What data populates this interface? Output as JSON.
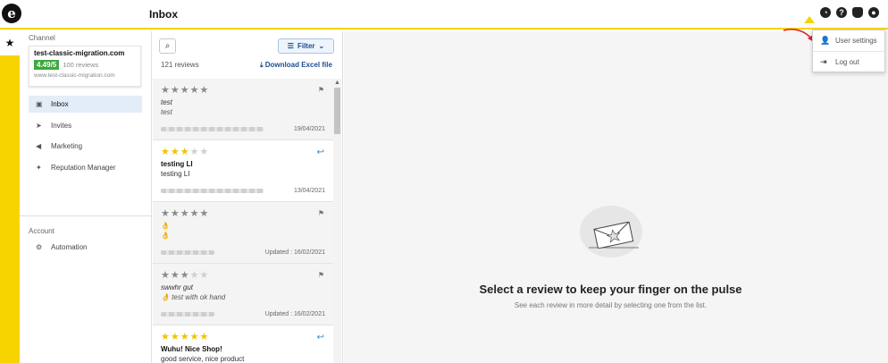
{
  "header": {
    "logo": "e",
    "title": "Inbox",
    "icons": [
      "speed-icon",
      "help-icon",
      "bell-icon",
      "user-icon"
    ]
  },
  "rail": {
    "star": "★"
  },
  "sidebar": {
    "channel_label": "Channel",
    "channel": {
      "name": "test-classic-migration.com",
      "rating": "4.49/5",
      "reviews": "100 reviews",
      "url": "www.test-classic-migration.com"
    },
    "items": [
      {
        "label": "Inbox",
        "icon": "inbox-icon"
      },
      {
        "label": "Invites",
        "icon": "send-icon"
      },
      {
        "label": "Marketing",
        "icon": "megaphone-icon"
      },
      {
        "label": "Reputation Manager",
        "icon": "sparkle-icon"
      }
    ],
    "account_label": "Account",
    "account_items": [
      {
        "label": "Automation",
        "icon": "automation-icon"
      }
    ]
  },
  "list": {
    "filter_label": "Filter",
    "count": "121 reviews",
    "download": "Download Excel file",
    "reviews": [
      {
        "stars": 5,
        "style": "grey",
        "title": "test",
        "body": "test",
        "date": "19/04/2021",
        "action": "flag"
      },
      {
        "stars": 3,
        "style": "rated",
        "title": "testing LI",
        "body": "testing LI",
        "date": "13/04/2021",
        "action": "reply"
      },
      {
        "stars": 5,
        "style": "grey",
        "title": "👌",
        "body": "👌",
        "date": "Updated : 16/02/2021",
        "action": "flag"
      },
      {
        "stars": 3,
        "style": "grey",
        "title": "swwhr gut",
        "body": "👌 test with ok hand",
        "date": "Updated : 16/02/2021",
        "action": "flag"
      },
      {
        "stars": 5,
        "style": "rated",
        "title": "Wuhu! Nice Shop!",
        "body": "good service, nice product",
        "date": "",
        "action": "reply"
      }
    ]
  },
  "detail": {
    "title": "Select a review to keep your finger on the pulse",
    "subtitle": "See each review in more detail by selecting one from the list."
  },
  "dropdown": {
    "items": [
      {
        "label": "User settings",
        "icon": "user-icon"
      },
      {
        "label": "Log out",
        "icon": "logout-icon"
      }
    ]
  },
  "colors": {
    "accent": "#f7d300",
    "link": "#1b4f8f",
    "rating_green": "#3fa83f",
    "star": "#f2c200"
  }
}
